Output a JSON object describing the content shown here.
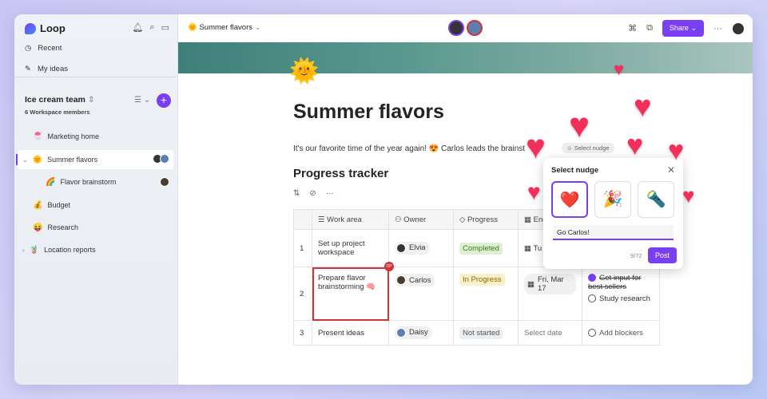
{
  "app": {
    "name": "Loop"
  },
  "sidebar": {
    "nav": [
      {
        "label": "Recent",
        "icon": "clock-icon"
      },
      {
        "label": "My ideas",
        "icon": "ideas-icon"
      }
    ],
    "workspace": {
      "name": "Ice cream team",
      "members": "6 Workspace members"
    },
    "items": [
      {
        "label": "Marketing home",
        "emoji": "🍧"
      },
      {
        "label": "Summer flavors",
        "emoji": "🌞"
      },
      {
        "label": "Flavor brainstorm",
        "emoji": "🌈"
      },
      {
        "label": "Budget",
        "emoji": "💰"
      },
      {
        "label": "Research",
        "emoji": "😝"
      },
      {
        "label": "Location reports",
        "emoji": "🧋"
      }
    ]
  },
  "header": {
    "page": "Summer flavors",
    "share": "Share",
    "accent": "#7b3ff2"
  },
  "doc": {
    "title": "Summer flavors",
    "paragraph": "It's our favorite time of the year again! 😍 Carlos leads the brainst",
    "nudge_chip": "Select nudge",
    "section": "Progress tracker"
  },
  "table": {
    "headers": [
      "Work area",
      "Owner",
      "Progress",
      "End date",
      ""
    ],
    "rows": [
      {
        "n": "1",
        "work": "Set up project workspace",
        "owner": "Elvia",
        "progress": "Completed",
        "date": "Tu",
        "tasks": []
      },
      {
        "n": "2",
        "work": "Prepare flavor brainstorming 🧠",
        "owner": "Carlos",
        "progress": "In Progress",
        "date": "Fri, Mar 17",
        "tasks": [
          "Get input for best sellers",
          "Study research"
        ],
        "badge": "DP"
      },
      {
        "n": "3",
        "work": "Present ideas",
        "owner": "Daisy",
        "progress": "Not started",
        "date": "Select date",
        "tasks": [
          "Add blockers"
        ]
      }
    ]
  },
  "popup": {
    "title": "Select nudge",
    "options": [
      "❤️",
      "🎉",
      "🔦"
    ],
    "input": "Go Carlos!",
    "count": "9/72",
    "post": "Post"
  }
}
